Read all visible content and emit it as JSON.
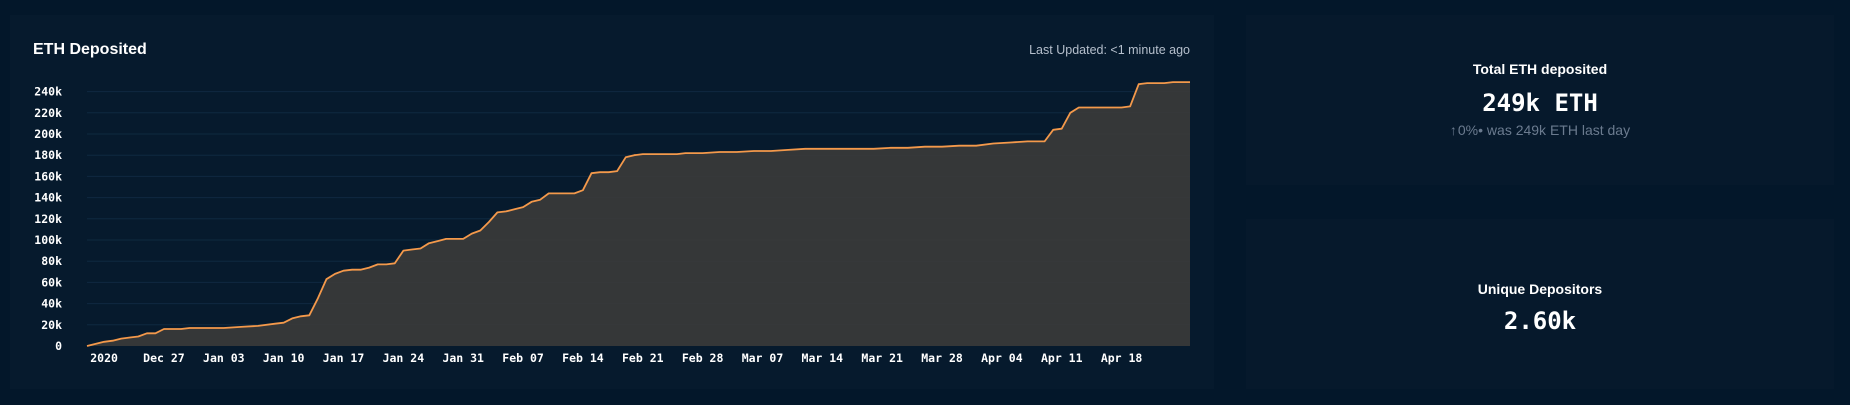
{
  "chart_card": {
    "title": "ETH Deposited",
    "last_updated": "Last Updated: <1 minute ago"
  },
  "stats": {
    "total": {
      "label": "Total ETH deposited",
      "value": "249k ETH",
      "change": "0%",
      "comparison": "• was 249k ETH last day",
      "arrow_icon": "arrow-up-icon"
    },
    "depositors": {
      "label": "Unique Depositors",
      "value": "2.60k"
    }
  },
  "colors": {
    "background": "#03172a",
    "card": "#06192c",
    "line": "#f4994b",
    "area": "#3a3a3a"
  },
  "chart_data": {
    "type": "area",
    "title": "ETH Deposited",
    "xlabel": "",
    "ylabel": "",
    "x_tick_labels": [
      "2020",
      "Dec 27",
      "Jan 03",
      "Jan 10",
      "Jan 17",
      "Jan 24",
      "Jan 31",
      "Feb 07",
      "Feb 14",
      "Feb 21",
      "Feb 28",
      "Mar 07",
      "Mar 14",
      "Mar 21",
      "Mar 28",
      "Apr 04",
      "Apr 11",
      "Apr 18"
    ],
    "y_tick_labels": [
      "0",
      "20k",
      "40k",
      "60k",
      "80k",
      "100k",
      "120k",
      "140k",
      "160k",
      "180k",
      "200k",
      "220k",
      "240k"
    ],
    "ylim": [
      0,
      250000
    ],
    "x_day_range": [
      -2,
      127
    ],
    "grid": true,
    "series": [
      {
        "x_days": [
          -2,
          0,
          1,
          2,
          3,
          4,
          5,
          6,
          7,
          8,
          9,
          10,
          11,
          12,
          14,
          16,
          18,
          20,
          21,
          22,
          23,
          24,
          25,
          26,
          27,
          28,
          29,
          30,
          31,
          32,
          33,
          34,
          35,
          36,
          37,
          38,
          39,
          40,
          41,
          42,
          43,
          44,
          45,
          46,
          47,
          48,
          49,
          50,
          51,
          52,
          53,
          54,
          55,
          56,
          57,
          58,
          59,
          60,
          61,
          62,
          63,
          64,
          65,
          66,
          67,
          68,
          70,
          72,
          74,
          76,
          78,
          80,
          82,
          84,
          86,
          88,
          90,
          92,
          94,
          96,
          98,
          100,
          102,
          104,
          106,
          108,
          110,
          111,
          112,
          113,
          114,
          115,
          116,
          117,
          118,
          119,
          120,
          121,
          122,
          123,
          124,
          125,
          126,
          127
        ],
        "values": [
          0,
          4000,
          5000,
          7000,
          8000,
          9000,
          12000,
          12000,
          16000,
          16000,
          16000,
          17000,
          17000,
          17000,
          17000,
          18000,
          19000,
          21000,
          22000,
          26000,
          28000,
          29000,
          45000,
          63000,
          68000,
          71000,
          72000,
          72000,
          74000,
          77000,
          77000,
          78000,
          90000,
          91000,
          92000,
          97000,
          99000,
          101000,
          101000,
          101000,
          106000,
          109000,
          117000,
          126000,
          127000,
          129000,
          131000,
          136000,
          138000,
          144000,
          144000,
          144000,
          144000,
          147000,
          163000,
          164000,
          164000,
          165000,
          178000,
          180000,
          181000,
          181000,
          181000,
          181000,
          181000,
          182000,
          182000,
          183000,
          183000,
          184000,
          184000,
          185000,
          186000,
          186000,
          186000,
          186000,
          186000,
          187000,
          187000,
          188000,
          188000,
          189000,
          189000,
          191000,
          192000,
          193000,
          193000,
          204000,
          205000,
          220000,
          225000,
          225000,
          225000,
          225000,
          225000,
          225000,
          226000,
          247000,
          248000,
          248000,
          248000,
          249000,
          249000,
          249000
        ]
      }
    ]
  }
}
